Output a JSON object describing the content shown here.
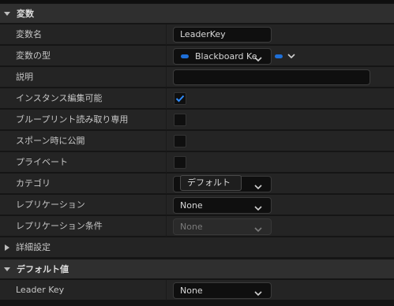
{
  "sections": {
    "variables": {
      "title": "変数"
    },
    "defaults": {
      "title": "デフォルト値"
    }
  },
  "rows": {
    "variable_name": {
      "label": "変数名",
      "value": "LeaderKey"
    },
    "variable_type": {
      "label": "変数の型",
      "value": "Blackboard Ke"
    },
    "description": {
      "label": "説明",
      "value": ""
    },
    "instance_editable": {
      "label": "インスタンス編集可能",
      "checked": true
    },
    "blueprint_readonly": {
      "label": "ブループリント読み取り専用",
      "checked": false
    },
    "expose_on_spawn": {
      "label": "スポーン時に公開",
      "checked": false
    },
    "private": {
      "label": "プライベート",
      "checked": false
    },
    "category": {
      "label": "カテゴリ",
      "value": "デフォルト"
    },
    "replication": {
      "label": "レプリケーション",
      "value": "None"
    },
    "replication_condition": {
      "label": "レプリケーション条件",
      "value": "None"
    },
    "advanced": {
      "label": "詳細設定"
    },
    "leader_key": {
      "label": "Leader Key",
      "value": "None"
    }
  },
  "colors": {
    "accent": "#1e6fd8",
    "panel": "#242424",
    "header": "#2f2f2f"
  }
}
